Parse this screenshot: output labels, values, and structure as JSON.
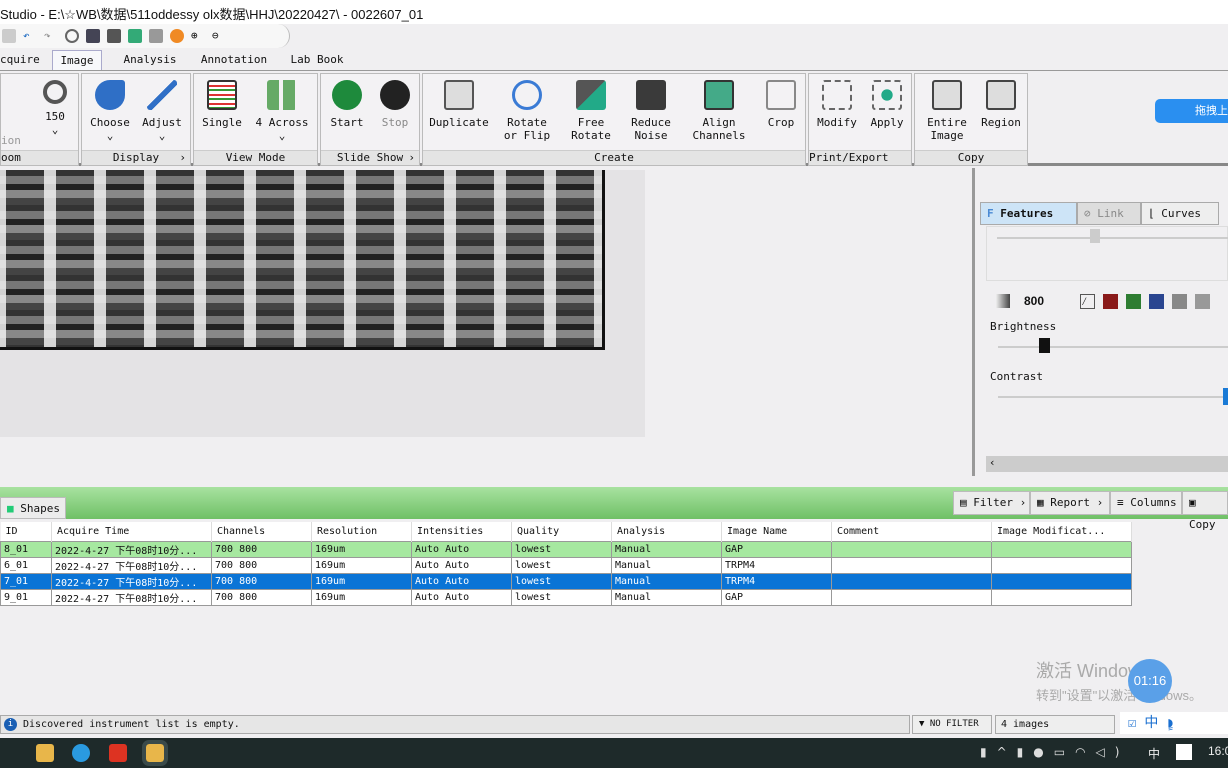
{
  "window": {
    "title": "Studio - E:\\☆WB\\数据\\511oddessy olx数据\\HHJ\\20220427\\ - 0022607_01"
  },
  "tabs": [
    "cquire",
    "Image",
    "Analysis",
    "Annotation",
    "Lab Book"
  ],
  "ribbon": {
    "zoom": {
      "label": "oom",
      "partial": "ion",
      "value": "150"
    },
    "display": {
      "label": "Display",
      "choose": "Choose",
      "adjust": "Adjust"
    },
    "view_mode": {
      "label": "View Mode",
      "single": "Single",
      "across": "4 Across"
    },
    "slide_show": {
      "label": "Slide Show",
      "start": "Start",
      "stop": "Stop"
    },
    "create": {
      "label": "Create",
      "duplicate": "Duplicate",
      "rotate": "Rotate or Flip",
      "free_rotate": "Free Rotate",
      "reduce_noise": "Reduce Noise",
      "align": "Align Channels",
      "crop": "Crop"
    },
    "print_export": {
      "label": "Print/Export ...",
      "modify": "Modify",
      "apply": "Apply"
    },
    "copy": {
      "label": "Copy",
      "entire": "Entire Image",
      "region": "Region"
    }
  },
  "cloud_button": "拖拽上",
  "right_panel": {
    "tabs": [
      "Features",
      "Link",
      "Curves"
    ],
    "channel_value": "800",
    "brightness_label": "Brightness",
    "contrast_label": "Contrast",
    "brightness_level": 0.2,
    "contrast_level": 1.0,
    "swatches": [
      "#8a1a1a",
      "#2e7d32",
      "#2a4590",
      "#888888",
      "#999999"
    ]
  },
  "list_bar": {
    "shapes_tab": "Shapes",
    "filter": "Filter",
    "report": "Report",
    "columns": "Columns",
    "copy": "Copy"
  },
  "table": {
    "headers": [
      "ID",
      "Acquire Time",
      "Channels",
      "Resolution",
      "Intensities",
      "Quality",
      "Analysis",
      "Image Name",
      "Comment",
      "Image Modificat..."
    ],
    "rows": [
      [
        "8_01",
        "2022-4-27 下午08时10分...",
        "700 800",
        "169um",
        "Auto Auto",
        "lowest",
        "Manual",
        "GAP",
        "",
        ""
      ],
      [
        "6_01",
        "2022-4-27 下午08时10分...",
        "700 800",
        "169um",
        "Auto Auto",
        "lowest",
        "Manual",
        "TRPM4",
        "",
        ""
      ],
      [
        "7_01",
        "2022-4-27 下午08时10分...",
        "700 800",
        "169um",
        "Auto Auto",
        "lowest",
        "Manual",
        "TRPM4",
        "",
        ""
      ],
      [
        "9_01",
        "2022-4-27 下午08时10分...",
        "700 800",
        "169um",
        "Auto Auto",
        "lowest",
        "Manual",
        "GAP",
        "",
        ""
      ]
    ],
    "selected_row": 2
  },
  "status": {
    "message": "Discovered instrument list is empty.",
    "filter": "NO FILTER",
    "count": "4 images"
  },
  "watermark": {
    "line1": "激活 Windows",
    "line2": "转到\"设置\"以激活Windows。"
  },
  "clock_bubble": "01:16",
  "taskbar": {
    "ime": "中",
    "time": "16:0"
  }
}
